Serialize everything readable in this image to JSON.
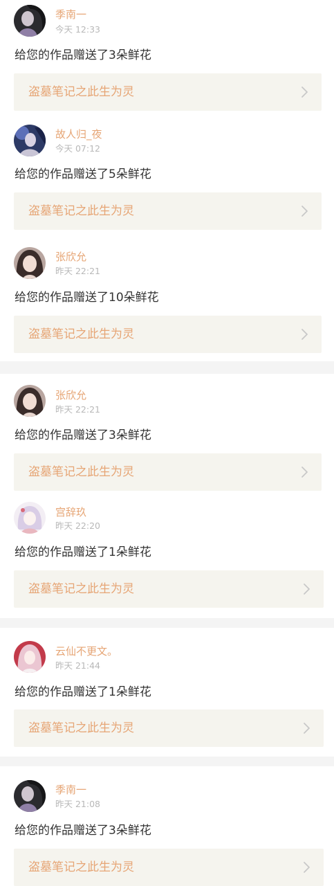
{
  "notifications": [
    {
      "user": "季南一",
      "time": "今天 12:33",
      "message": "给您的作品赠送了3朵鲜花",
      "work": "盗墓笔记之此生为灵",
      "avatar": "dark-portrait"
    },
    {
      "user": "故人归_夜",
      "time": "今天 07:12",
      "message": "给您的作品赠送了5朵鲜花",
      "work": "盗墓笔记之此生为灵",
      "avatar": "night-portrait"
    },
    {
      "user": "张欣允",
      "time": "昨天 22:21",
      "message": "给您的作品赠送了10朵鲜花",
      "work": "盗墓笔记之此生为灵",
      "avatar": "girl-portrait"
    },
    {
      "user": "张欣允",
      "time": "昨天 22:21",
      "message": "给您的作品赠送了3朵鲜花",
      "work": "盗墓笔记之此生为灵",
      "avatar": "girl-portrait"
    },
    {
      "user": "宫辞玖",
      "time": "昨天 22:20",
      "message": "给您的作品赠送了1朵鲜花",
      "work": "盗墓笔记之此生为灵",
      "avatar": "anime-portrait"
    },
    {
      "user": "云仙不更文。",
      "time": "昨天 21:44",
      "message": "给您的作品赠送了1朵鲜花",
      "work": "盗墓笔记之此生为灵",
      "avatar": "pink-hair-portrait"
    },
    {
      "user": "季南一",
      "time": "昨天 21:08",
      "message": "给您的作品赠送了3朵鲜花",
      "work": "盗墓笔记之此生为灵",
      "avatar": "dark-portrait"
    }
  ],
  "colors": {
    "accent": "#e6a575",
    "card_bg": "#f5f4ee",
    "text": "#333333",
    "muted": "#b8b8b8",
    "divider": "#f4f4f4"
  },
  "icons": {
    "chevron": "chevron-right-icon"
  }
}
